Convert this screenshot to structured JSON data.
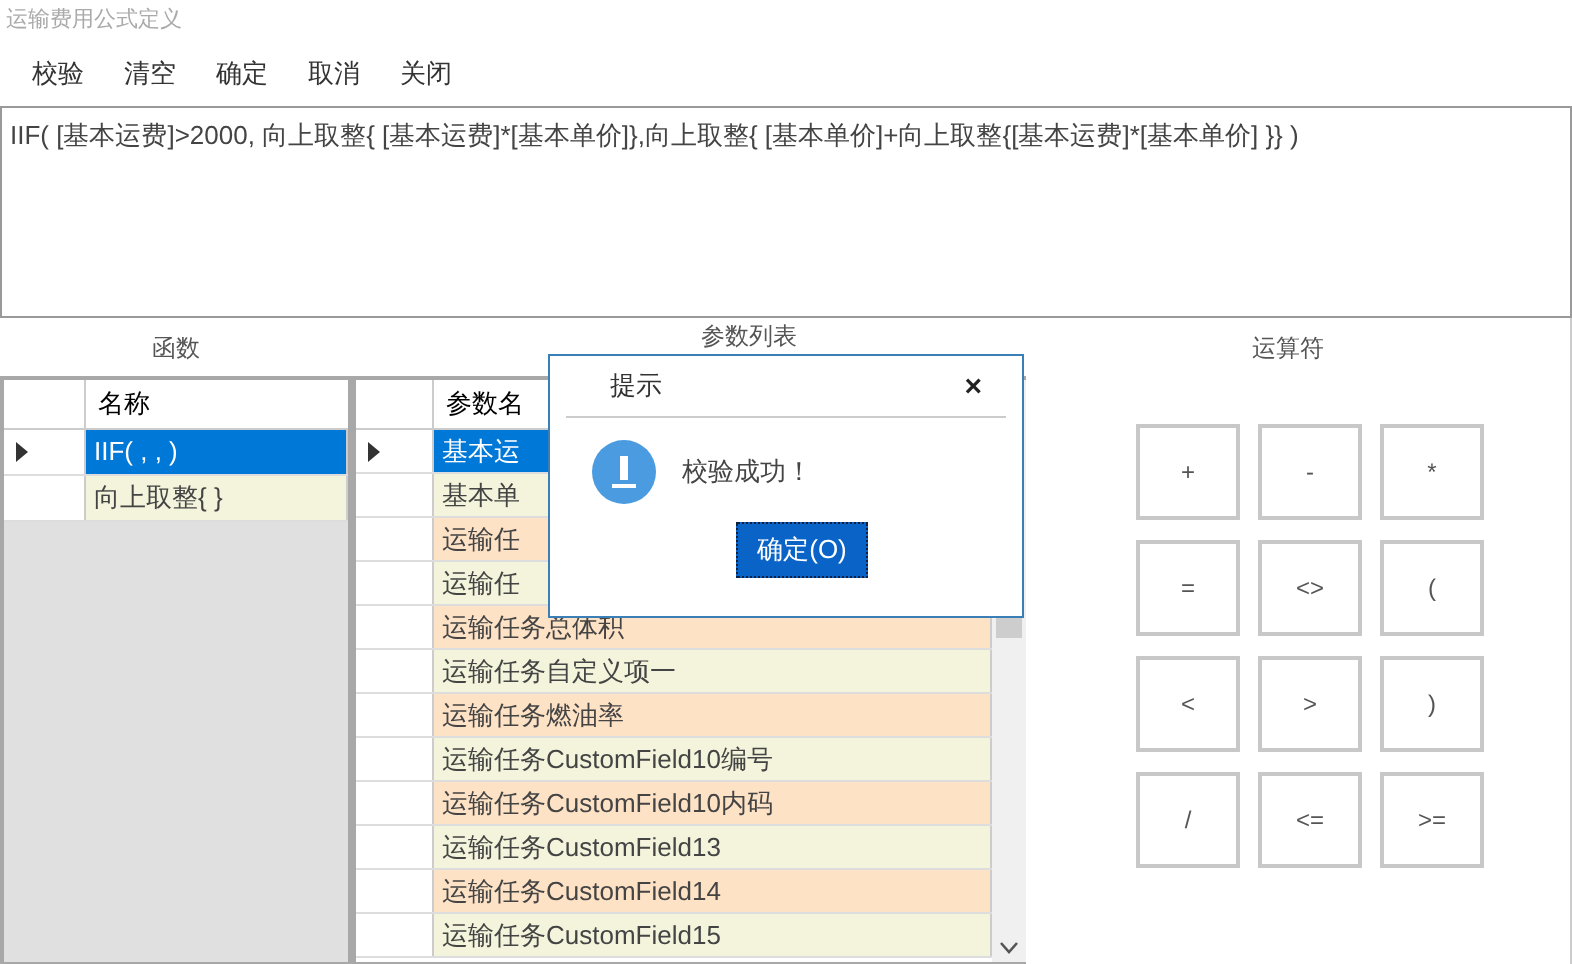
{
  "window": {
    "title": "运输费用公式定义"
  },
  "toolbar": [
    "校验",
    "清空",
    "确定",
    "取消",
    "关闭"
  ],
  "formula": {
    "value": "IIF( [基本运费]>2000, 向上取整{ [基本运费]*[基本单价]},向上取整{ [基本单价]+向上取整{[基本运费]*[基本单价] }} )"
  },
  "functions": {
    "label": "函数",
    "column": "名称",
    "rows": [
      {
        "name": "IIF( , , )",
        "selected": true
      },
      {
        "name": "向上取整{ }",
        "selected": false
      }
    ]
  },
  "parameters": {
    "label": "参数列表",
    "column": "参数名",
    "rows": [
      {
        "name": "基本运",
        "selected": true
      },
      {
        "name": "基本单",
        "selected": false
      },
      {
        "name": "运输任",
        "selected": false
      },
      {
        "name": "运输任",
        "selected": false
      },
      {
        "name": "运输任务总体积",
        "selected": false
      },
      {
        "name": "运输任务自定义项一",
        "selected": false
      },
      {
        "name": "运输任务燃油率",
        "selected": false
      },
      {
        "name": "运输任务CustomField10编号",
        "selected": false
      },
      {
        "name": "运输任务CustomField10内码",
        "selected": false
      },
      {
        "name": "运输任务CustomField13",
        "selected": false
      },
      {
        "name": "运输任务CustomField14",
        "selected": false
      },
      {
        "name": "运输任务CustomField15",
        "selected": false
      }
    ]
  },
  "operators": {
    "label": "运算符",
    "buttons": [
      "+",
      "-",
      "*",
      "=",
      "<>",
      "(",
      "<",
      ">",
      ")",
      "/",
      "<=",
      ">="
    ]
  },
  "dialog": {
    "title": "提示",
    "close": "×",
    "message": "校验成功！",
    "button": "确定(O)"
  }
}
